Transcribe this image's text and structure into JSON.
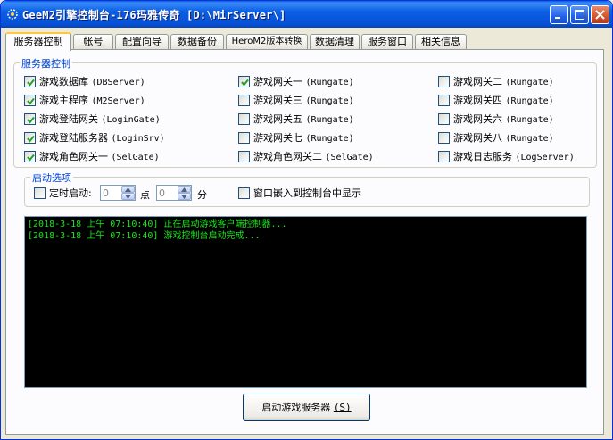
{
  "window": {
    "title": "GeeM2引擎控制台-176玛雅传奇 [D:\\MirServer\\]"
  },
  "tabs": [
    {
      "label": "服务器控制",
      "active": true
    },
    {
      "label": "帐号",
      "active": false
    },
    {
      "label": "配置向导",
      "active": false
    },
    {
      "label": "数据备份",
      "active": false
    },
    {
      "label": "HeroM2版本转换",
      "active": false
    },
    {
      "label": "数据清理",
      "active": false
    },
    {
      "label": "服务窗口",
      "active": false
    },
    {
      "label": "相关信息",
      "active": false
    }
  ],
  "server_group": {
    "legend": "服务器控制",
    "col1": [
      {
        "cn": "游戏数据库",
        "en": "(DBServer)",
        "checked": true
      },
      {
        "cn": "游戏主程序",
        "en": "(M2Server)",
        "checked": true
      },
      {
        "cn": "游戏登陆网关",
        "en": "(LoginGate)",
        "checked": true
      },
      {
        "cn": "游戏登陆服务器",
        "en": "(LoginSrv)",
        "checked": true
      },
      {
        "cn": "游戏角色网关一",
        "en": "(SelGate)",
        "checked": true
      }
    ],
    "col2": [
      {
        "cn": "游戏网关一",
        "en": "(Rungate)",
        "checked": true
      },
      {
        "cn": "游戏网关三",
        "en": "(Rungate)",
        "checked": false
      },
      {
        "cn": "游戏网关五",
        "en": "(Rungate)",
        "checked": false
      },
      {
        "cn": "游戏网关七",
        "en": "(Rungate)",
        "checked": false
      },
      {
        "cn": "游戏角色网关二",
        "en": "(SelGate)",
        "checked": false
      }
    ],
    "col3": [
      {
        "cn": "游戏网关二",
        "en": "(Rungate)",
        "checked": false
      },
      {
        "cn": "游戏网关四",
        "en": "(Rungate)",
        "checked": false
      },
      {
        "cn": "游戏网关六",
        "en": "(Rungate)",
        "checked": false
      },
      {
        "cn": "游戏网关八",
        "en": "(Rungate)",
        "checked": false
      },
      {
        "cn": "游戏日志服务",
        "en": "(LogServer)",
        "checked": false
      }
    ]
  },
  "startup_group": {
    "legend": "启动选项",
    "timer_label": "定时启动:",
    "timer_checked": false,
    "hour_value": "0",
    "hour_unit": "点",
    "minute_value": "0",
    "minute_unit": "分",
    "embed_label": "窗口嵌入到控制台中显示",
    "embed_checked": false
  },
  "console": {
    "lines": [
      "[2018-3-18 上午 07:10:40] 正在启动游戏客户端控制器...",
      "[2018-3-18 上午 07:10:40] 游戏控制台启动完成..."
    ]
  },
  "start_button": {
    "label": "启动游戏服务器",
    "hotkey": "(S)"
  },
  "colors": {
    "accent": "#0046d5",
    "console_text": "#19e619",
    "console_bg": "#000000"
  }
}
